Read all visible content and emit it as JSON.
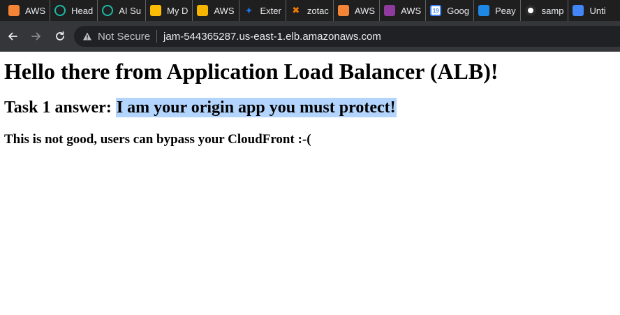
{
  "bookmarks": [
    {
      "label": "AWS",
      "icon": "aws-cube-icon",
      "color": "#f58536"
    },
    {
      "label": "Head",
      "icon": "perplexity-icon",
      "color": "#1fb8a6"
    },
    {
      "label": "AI Su",
      "icon": "perplexity-icon",
      "color": "#1fb8a6"
    },
    {
      "label": "My D",
      "icon": "google-drive-icon",
      "color": "#fbbc04"
    },
    {
      "label": "AWS",
      "icon": "google-slides-icon",
      "color": "#f4b400"
    },
    {
      "label": "Exter",
      "icon": "puzzle-icon",
      "color": "#1a73e8"
    },
    {
      "label": "zotac",
      "icon": "zotac-icon",
      "color": "#f57c00"
    },
    {
      "label": "AWS",
      "icon": "aws-cube-icon",
      "color": "#f58536"
    },
    {
      "label": "AWS",
      "icon": "aws-gradient-icon",
      "color": "#8e3a9e"
    },
    {
      "label": "Goog",
      "icon": "google-calendar-icon",
      "color": "#4285f4",
      "badge": "19"
    },
    {
      "label": "Peay",
      "icon": "peay-icon",
      "color": "#1e88e5"
    },
    {
      "label": "samp",
      "icon": "github-icon",
      "color": "#2b2b2b"
    },
    {
      "label": "Unti",
      "icon": "google-docs-icon",
      "color": "#4285f4"
    }
  ],
  "toolbar": {
    "not_secure": "Not Secure",
    "url": "jam-544365287.us-east-1.elb.amazonaws.com"
  },
  "page": {
    "heading": "Hello there from Application Load Balancer (ALB)!",
    "task_prefix": "Task 1 answer: ",
    "task_answer": "I am your origin app you must protect!",
    "warning": "This is not good, users can bypass your CloudFront :-("
  }
}
